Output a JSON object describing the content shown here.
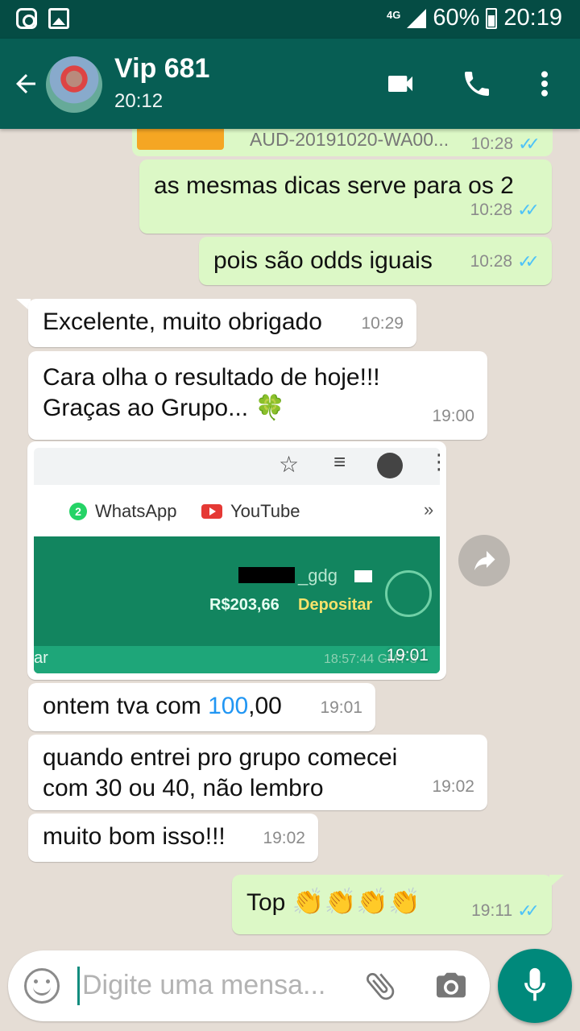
{
  "status_bar": {
    "network": "4G",
    "battery": "60%",
    "clock": "20:19"
  },
  "header": {
    "contact_name": "Vip 681",
    "last_seen": "20:12"
  },
  "messages": [
    {
      "id": "m0",
      "dir": "out",
      "text": "AUD-20191020-WA00...",
      "time": "10:28",
      "kind": "audio-partial"
    },
    {
      "id": "m1",
      "dir": "out",
      "text": "as mesmas dicas serve para os 2",
      "time": "10:28"
    },
    {
      "id": "m2",
      "dir": "out",
      "text": "pois são odds iguais",
      "time": "10:28"
    },
    {
      "id": "m3",
      "dir": "in",
      "text": "Excelente, muito obrigado",
      "time": "10:29"
    },
    {
      "id": "m4",
      "dir": "in",
      "line1": "Cara olha o resultado de hoje!!!",
      "line2": "Graças ao Grupo...",
      "emoji": "🍀",
      "time": "19:00"
    },
    {
      "id": "m5",
      "dir": "in",
      "kind": "image",
      "time": "19:01",
      "image": {
        "bookmark1": "WhatsApp",
        "bookmark2": "YouTube",
        "wa_count": "2",
        "username": "_gdg",
        "balance": "R$203,66",
        "deposit": "Depositar",
        "footer_left": "ar",
        "footer_right": "18:57:44 GMT-3"
      }
    },
    {
      "id": "m6",
      "dir": "in",
      "text_before": "ontem tva com ",
      "highlight": "100",
      "text_after": ",00",
      "time": "19:01"
    },
    {
      "id": "m7",
      "dir": "in",
      "line1": "quando entrei pro grupo comecei",
      "line2": "com 30 ou 40, não lembro",
      "time": "19:02"
    },
    {
      "id": "m8",
      "dir": "in",
      "text": "muito bom isso!!!",
      "time": "19:02"
    },
    {
      "id": "m9",
      "dir": "out",
      "text": "Top",
      "emoji": "👏👏👏👏",
      "time": "19:11"
    }
  ],
  "input": {
    "placeholder": "Digite uma mensa..."
  },
  "colors": {
    "header": "#075e54",
    "status": "#054c44",
    "outgoing": "#dcf8c6",
    "incoming": "#ffffff",
    "accent": "#00897b",
    "ticks": "#4fc3f7"
  }
}
